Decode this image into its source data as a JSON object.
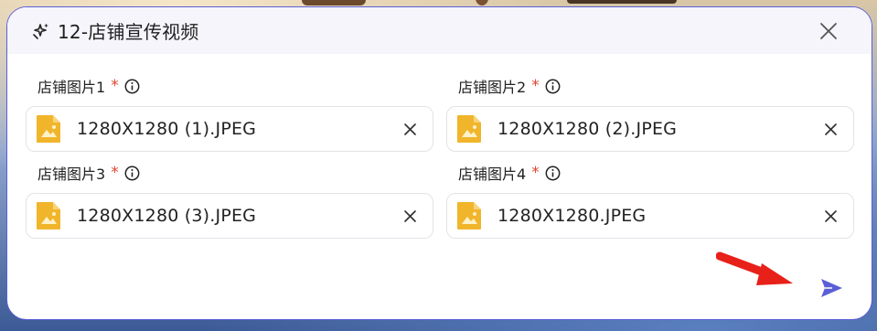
{
  "dialog": {
    "title": "12-店铺宣传视频",
    "header_icon": "sparkle-icon",
    "close_icon": "close-icon"
  },
  "fields": [
    {
      "label": "店铺图片1",
      "required_mark": "*",
      "file_name": "1280X1280 (1).JPEG"
    },
    {
      "label": "店铺图片2",
      "required_mark": "*",
      "file_name": "1280X1280 (2).JPEG"
    },
    {
      "label": "店铺图片3",
      "required_mark": "*",
      "file_name": "1280X1280 (3).JPEG"
    },
    {
      "label": "店铺图片4",
      "required_mark": "*",
      "file_name": "1280X1280.JPEG"
    }
  ],
  "send_icon": "send-icon",
  "colors": {
    "accent": "#5b5fd6",
    "required": "#e0452f",
    "file_icon": "#f1b52c",
    "annotation_arrow": "#e8201a"
  }
}
